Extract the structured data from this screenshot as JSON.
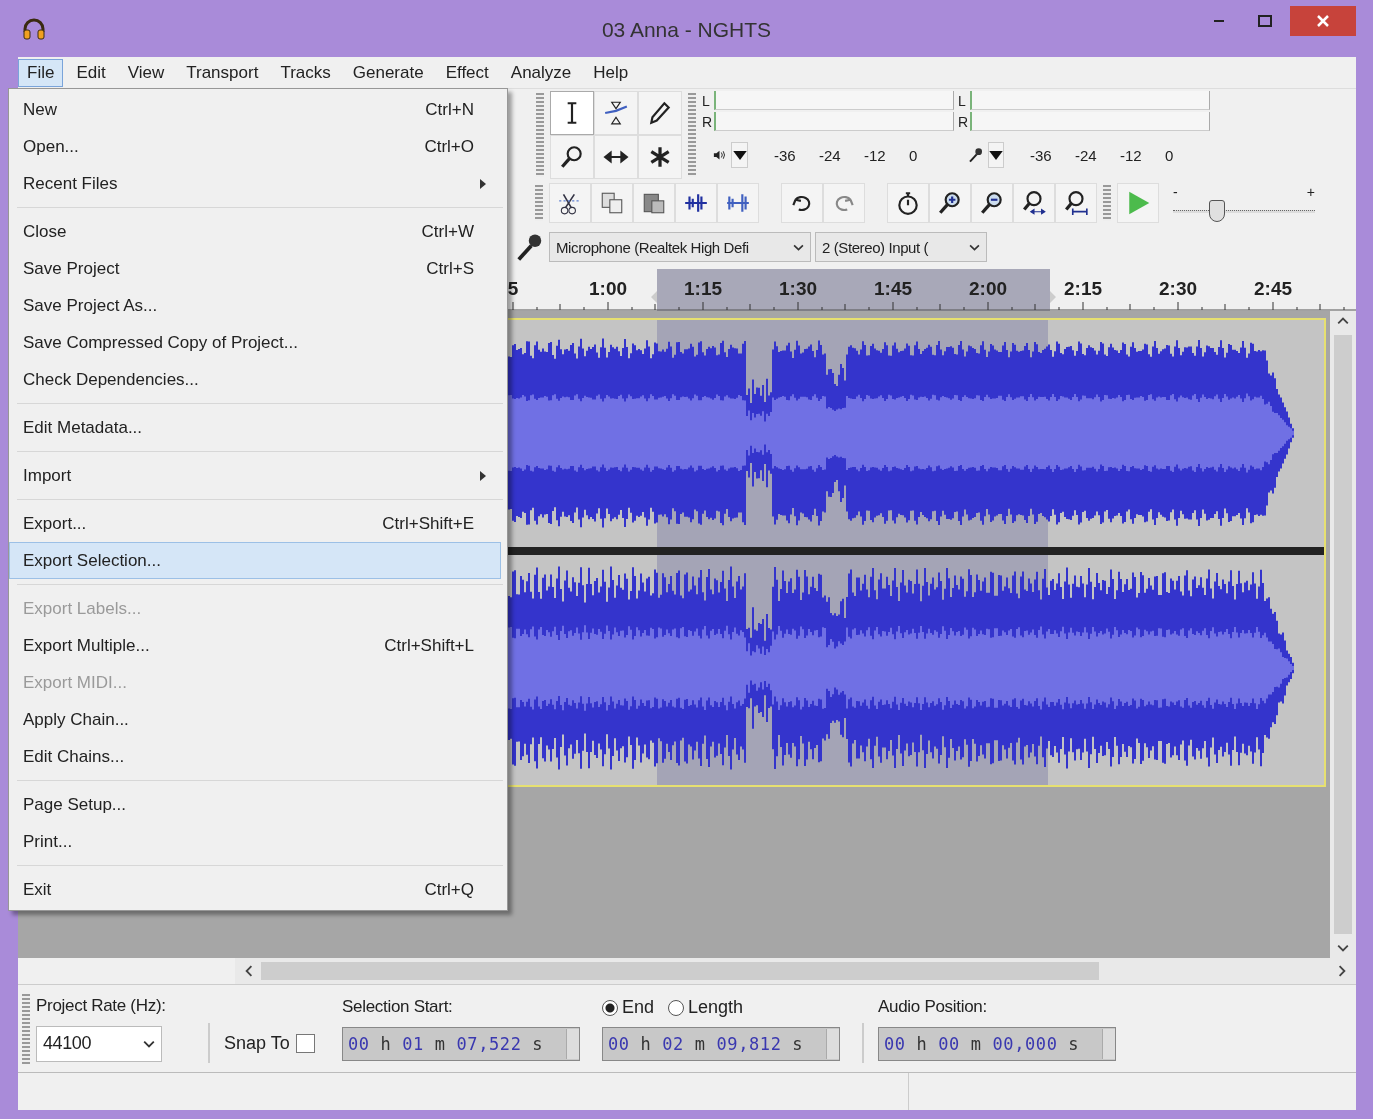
{
  "window": {
    "title": "03 Anna - NGHTS"
  },
  "menu_bar": [
    {
      "label": "File",
      "selected": true
    },
    {
      "label": "Edit",
      "selected": false
    },
    {
      "label": "View",
      "selected": false
    },
    {
      "label": "Transport",
      "selected": false
    },
    {
      "label": "Tracks",
      "selected": false
    },
    {
      "label": "Generate",
      "selected": false
    },
    {
      "label": "Effect",
      "selected": false
    },
    {
      "label": "Analyze",
      "selected": false
    },
    {
      "label": "Help",
      "selected": false
    }
  ],
  "file_menu": [
    {
      "kind": "item",
      "label": "New",
      "shortcut": "Ctrl+N",
      "submenu": false,
      "disabled": false,
      "selected": false
    },
    {
      "kind": "item",
      "label": "Open...",
      "shortcut": "Ctrl+O",
      "submenu": false,
      "disabled": false,
      "selected": false
    },
    {
      "kind": "item",
      "label": "Recent Files",
      "submenu": true,
      "disabled": false,
      "selected": false
    },
    {
      "kind": "separator"
    },
    {
      "kind": "item",
      "label": "Close",
      "shortcut": "Ctrl+W",
      "submenu": false,
      "disabled": false,
      "selected": false
    },
    {
      "kind": "item",
      "label": "Save Project",
      "shortcut": "Ctrl+S",
      "submenu": false,
      "disabled": false,
      "selected": false
    },
    {
      "kind": "item",
      "label": "Save Project As...",
      "submenu": false,
      "disabled": false,
      "selected": false
    },
    {
      "kind": "item",
      "label": "Save Compressed Copy of Project...",
      "submenu": false,
      "disabled": false,
      "selected": false
    },
    {
      "kind": "item",
      "label": "Check Dependencies...",
      "submenu": false,
      "disabled": false,
      "selected": false
    },
    {
      "kind": "separator"
    },
    {
      "kind": "item",
      "label": "Edit Metadata...",
      "submenu": false,
      "disabled": false,
      "selected": false
    },
    {
      "kind": "separator"
    },
    {
      "kind": "item",
      "label": "Import",
      "submenu": true,
      "disabled": false,
      "selected": false
    },
    {
      "kind": "separator"
    },
    {
      "kind": "item",
      "label": "Export...",
      "shortcut": "Ctrl+Shift+E",
      "submenu": false,
      "disabled": false,
      "selected": false
    },
    {
      "kind": "item",
      "label": "Export Selection...",
      "submenu": false,
      "disabled": false,
      "selected": true
    },
    {
      "kind": "separator"
    },
    {
      "kind": "item",
      "label": "Export Labels...",
      "submenu": false,
      "disabled": true,
      "selected": false
    },
    {
      "kind": "item",
      "label": "Export Multiple...",
      "shortcut": "Ctrl+Shift+L",
      "submenu": false,
      "disabled": false,
      "selected": false
    },
    {
      "kind": "item",
      "label": "Export MIDI...",
      "submenu": false,
      "disabled": true,
      "selected": false
    },
    {
      "kind": "item",
      "label": "Apply Chain...",
      "submenu": false,
      "disabled": false,
      "selected": false
    },
    {
      "kind": "item",
      "label": "Edit Chains...",
      "submenu": false,
      "disabled": false,
      "selected": false
    },
    {
      "kind": "separator"
    },
    {
      "kind": "item",
      "label": "Page Setup...",
      "submenu": false,
      "disabled": false,
      "selected": false
    },
    {
      "kind": "item",
      "label": "Print...",
      "submenu": false,
      "disabled": false,
      "selected": false
    },
    {
      "kind": "separator"
    },
    {
      "kind": "item",
      "label": "Exit",
      "shortcut": "Ctrl+Q",
      "submenu": false,
      "disabled": false,
      "selected": false
    }
  ],
  "meters": [
    {
      "kind": "playback",
      "channels": [
        "L",
        "R"
      ],
      "scale": [
        "-36",
        "-24",
        "-12",
        "0"
      ]
    },
    {
      "kind": "recording",
      "channels": [
        "L",
        "R"
      ],
      "scale": [
        "-36",
        "-24",
        "-12",
        "0"
      ]
    }
  ],
  "play_at_speed": {
    "min_label": "-",
    "max_label": "+",
    "level": 0.3
  },
  "device_toolbar": {
    "input_device": "Microphone (Realtek High Defi",
    "input_channels": "2 (Stereo) Input ("
  },
  "ruler": {
    "labels": [
      "5",
      "1:00",
      "1:15",
      "1:30",
      "1:45",
      "2:00",
      "2:15",
      "2:30",
      "2:45"
    ]
  },
  "selection_toolbar": {
    "project_rate_label": "Project Rate (Hz):",
    "project_rate": "44100",
    "snap_to_label": "Snap To",
    "snap_to_checked": false,
    "selection_start_label": "Selection Start:",
    "selection_start": "00 h 01 m 07,522 s",
    "modes": [
      {
        "label": "End",
        "selected": true
      },
      {
        "label": "Length",
        "selected": false
      }
    ],
    "selection_end": "00 h 02 m 09,812 s",
    "audio_position_label": "Audio Position:",
    "audio_position": "00 h 00 m 00,000 s"
  }
}
